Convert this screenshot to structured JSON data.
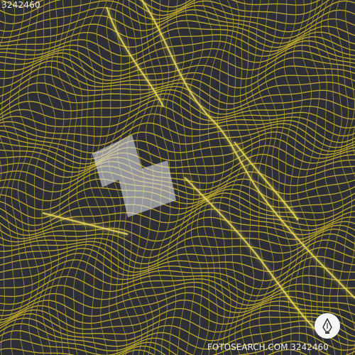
{
  "image_id_top": "3242460",
  "watermark": {
    "text": "FOTOSEARCH.COM 3242460",
    "badge_icon": "pen-nib-icon",
    "logo_icon": "stock-logo-watermark-icon"
  },
  "colors": {
    "background": "#2e2f36",
    "mesh": "#b8a52a",
    "mesh_highlight": "#f3e15a"
  }
}
